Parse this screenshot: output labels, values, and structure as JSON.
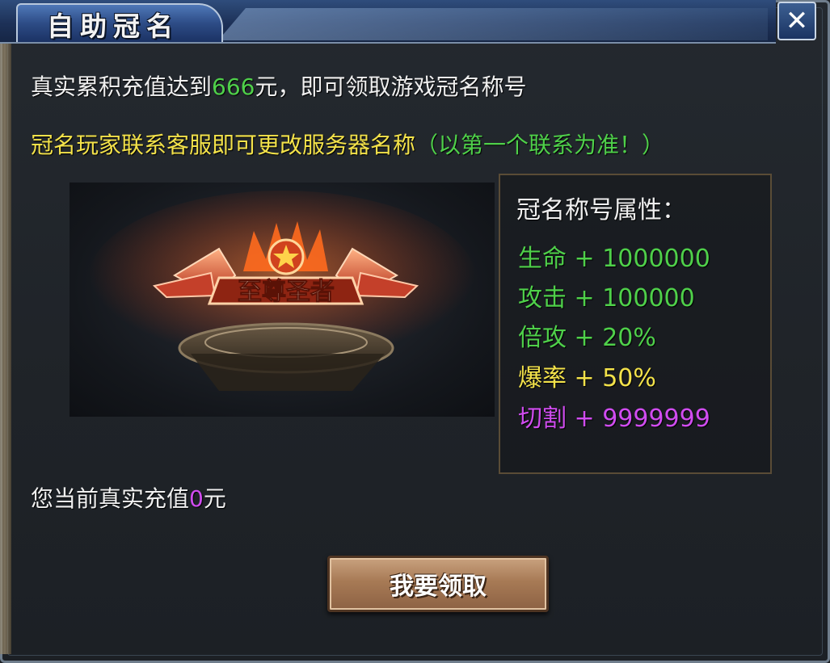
{
  "window": {
    "title": "自助冠名",
    "close_symbol": "✕"
  },
  "info": {
    "line1_prefix": "真实累积充值达到",
    "line1_amount": "666",
    "line1_suffix": "元，即可领取游戏冠名称号",
    "line2_main": "冠名玩家联系客服即可更改服务器名称",
    "line2_note": "（以第一个联系为准！）"
  },
  "badge_text": "至尊圣者",
  "attributes": {
    "title": "冠名称号属性：",
    "items": [
      {
        "label": "生命 + 1000000",
        "color": "#4fd04a"
      },
      {
        "label": "攻击 + 100000",
        "color": "#4fd04a"
      },
      {
        "label": "倍攻 + 20%",
        "color": "#4fd04a"
      },
      {
        "label": "爆率 + 50%",
        "color": "#f3e24a"
      },
      {
        "label": "切割 + 9999999",
        "color": "#d04cf0"
      }
    ]
  },
  "current": {
    "prefix": "您当前真实充值",
    "amount": "0",
    "suffix": "元"
  },
  "claim_button": {
    "label": "我要领取"
  },
  "colors": {
    "green": "#4fd04a",
    "yellow": "#f3e24a",
    "purple": "#d04cf0",
    "button": "#a77a55"
  }
}
